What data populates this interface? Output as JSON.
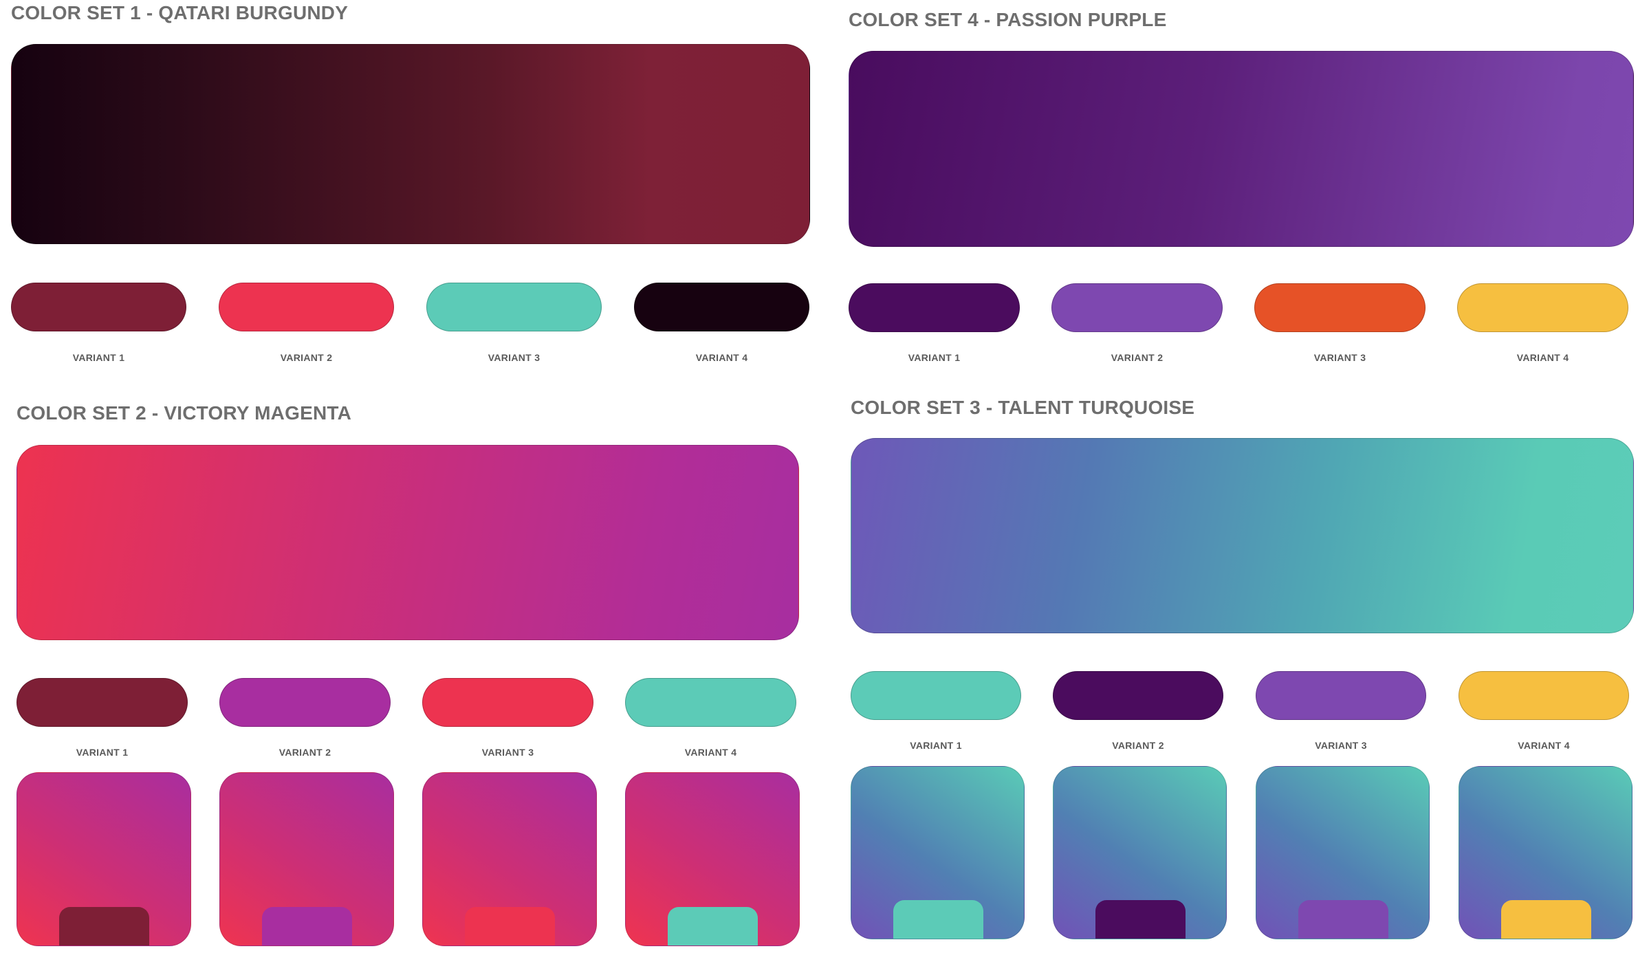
{
  "colors": {
    "burgundy": "#7e1f36",
    "red": "#ed3350",
    "turquoise": "#5ccbb7",
    "black_burgundy": "#170210",
    "dark_purple": "#4b0c5e",
    "purple": "#7e48b0",
    "orange": "#e65227",
    "yellow": "#f6bf40",
    "magenta": "#a82ea0"
  },
  "sets": [
    {
      "title": "COLOR SET 1 - QATARI BURGUNDY",
      "variants": [
        {
          "label": "VARIANT 1",
          "color": "#7e1f36"
        },
        {
          "label": "VARIANT 2",
          "color": "#ed3350"
        },
        {
          "label": "VARIANT 3",
          "color": "#5ccbb7"
        },
        {
          "label": "VARIANT 4",
          "color": "#170210"
        }
      ]
    },
    {
      "title": "COLOR SET 4 - PASSION PURPLE",
      "variants": [
        {
          "label": "VARIANT 1",
          "color": "#4b0c5e"
        },
        {
          "label": "VARIANT 2",
          "color": "#7e48b0"
        },
        {
          "label": "VARIANT 3",
          "color": "#e65227"
        },
        {
          "label": "VARIANT 4",
          "color": "#f6bf40"
        }
      ]
    },
    {
      "title": "COLOR SET 2 - VICTORY MAGENTA",
      "variants": [
        {
          "label": "VARIANT 1",
          "color": "#7e1f36"
        },
        {
          "label": "VARIANT 2",
          "color": "#a82ea0"
        },
        {
          "label": "VARIANT 3",
          "color": "#ed3350"
        },
        {
          "label": "VARIANT 4",
          "color": "#5ccbb7"
        }
      ],
      "cards": [
        "#7e1f36",
        "#a82ea0",
        "#ed3350",
        "#5ccbb7"
      ]
    },
    {
      "title": "COLOR SET 3 - TALENT TURQUOISE",
      "variants": [
        {
          "label": "VARIANT 1",
          "color": "#5ccbb7"
        },
        {
          "label": "VARIANT 2",
          "color": "#4b0c5e"
        },
        {
          "label": "VARIANT 3",
          "color": "#7e48b0"
        },
        {
          "label": "VARIANT 4",
          "color": "#f6bf40"
        }
      ],
      "cards": [
        "#5ccbb7",
        "#4b0c5e",
        "#7e48b0",
        "#f6bf40"
      ]
    }
  ]
}
